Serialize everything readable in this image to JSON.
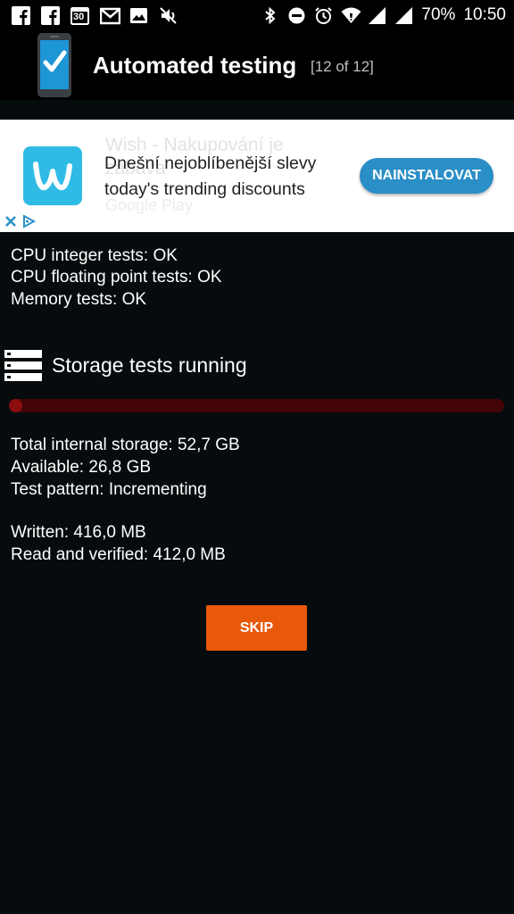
{
  "status_bar": {
    "left_icons": [
      "facebook-icon",
      "facebook-icon",
      "calendar-icon",
      "gmail-icon",
      "gallery-icon",
      "mute-icon"
    ],
    "calendar_day": "30",
    "right_icons": [
      "bluetooth-icon",
      "dnd-icon",
      "alarm-icon",
      "wifi-icon",
      "signal-icon",
      "signal-icon"
    ],
    "battery": "70%",
    "time": "10:50"
  },
  "app_bar": {
    "title": "Automated testing",
    "counter": "[12 of 12]",
    "icon": "phone-check-icon"
  },
  "ad": {
    "ghost_title": "Wish - Nakupování je zábava",
    "ghost_store": "Google Play",
    "line1": "Dnešní nejoblíbenější slevy",
    "line2": "today's trending discounts",
    "cta_label": "NAINSTALOVAT",
    "logo_letter": "w",
    "colors": {
      "cta": "#2a8ec7",
      "logo": "#2fbbe6"
    }
  },
  "results": {
    "cpu_integer": "CPU integer tests: OK",
    "cpu_float": "CPU floating point tests: OK",
    "memory": "Memory tests: OK"
  },
  "storage": {
    "title": "Storage tests running",
    "progress_fraction": 0.02,
    "total": "Total internal storage: 52,7 GB",
    "available": "Available: 26,8 GB",
    "pattern": "Test pattern: Incrementing",
    "written": "Written: 416,0 MB",
    "read_verified": "Read and verified: 412,0 MB"
  },
  "skip_label": "SKIP",
  "colors": {
    "background": "#060b0e",
    "progress_track": "#430505",
    "progress_fill": "#8b0d0d",
    "skip_button": "#e8590c"
  }
}
